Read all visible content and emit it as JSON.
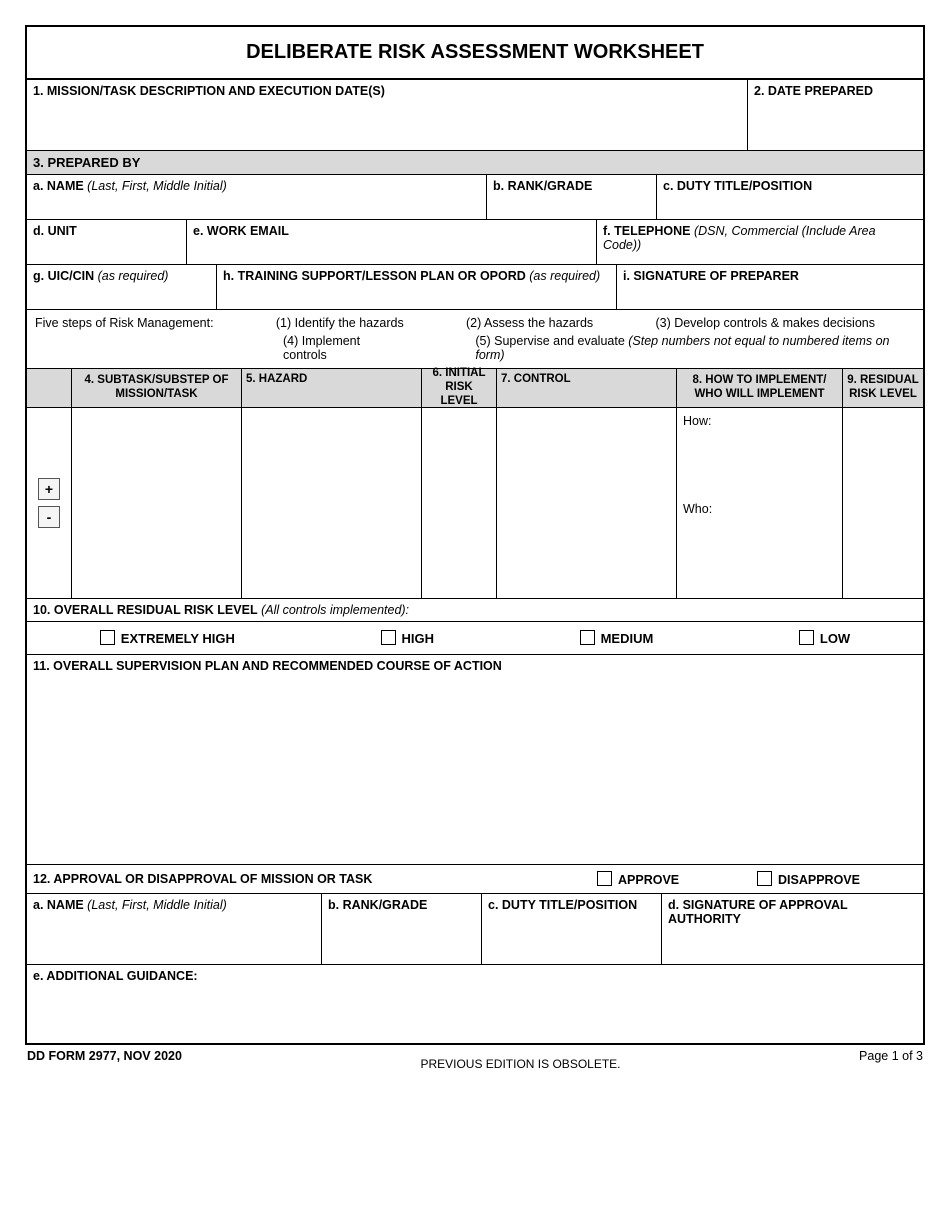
{
  "title": "DELIBERATE RISK ASSESSMENT WORKSHEET",
  "sec1": {
    "label": "1. MISSION/TASK DESCRIPTION AND EXECUTION DATE(S)"
  },
  "sec2": {
    "label": "2. DATE PREPARED"
  },
  "sec3": {
    "label": "3. PREPARED BY",
    "a_b": "a. NAME",
    "a_i": " (Last, First, Middle Initial)",
    "b": "b. RANK/GRADE",
    "c": "c. DUTY TITLE/POSITION",
    "d": "d. UNIT",
    "e": "e. WORK EMAIL",
    "f_b": "f. TELEPHONE",
    "f_i": " (DSN, Commercial (Include Area Code))",
    "g_b": "g. UIC/CIN",
    "g_i": " (as required)",
    "h_b": "h. TRAINING SUPPORT/LESSON PLAN OR OPORD",
    "h_i": " (as required)",
    "i": "i. SIGNATURE OF PREPARER"
  },
  "steps": {
    "intro": "Five steps of Risk Management:",
    "s1": "(1) Identify the hazards",
    "s2": "(2) Assess the hazards",
    "s3": "(3) Develop controls & makes decisions",
    "s4": "(4) Implement controls",
    "s5_a": "(5) Supervise and evaluate ",
    "s5_b": "(Step numbers not equal to numbered items on form)"
  },
  "tbl": {
    "pm": "",
    "c4a": "4. SUBTASK/SUBSTEP OF",
    "c4b": "MISSION/TASK",
    "c5": "5. HAZARD",
    "c6a": "6. INITIAL",
    "c6b": "RISK LEVEL",
    "c7": "7. CONTROL",
    "c8a": "8. HOW TO IMPLEMENT/",
    "c8b": "WHO WILL IMPLEMENT",
    "c9a": "9. RESIDUAL",
    "c9b": "RISK LEVEL",
    "how": "How:",
    "who": "Who:",
    "plus": "+",
    "minus": "-"
  },
  "sec10": {
    "label_b": "10. OVERALL RESIDUAL RISK LEVEL",
    "label_i": " (All controls implemented):",
    "o1": "EXTREMELY HIGH",
    "o2": "HIGH",
    "o3": "MEDIUM",
    "o4": "LOW"
  },
  "sec11": {
    "label": "11. OVERALL SUPERVISION PLAN AND RECOMMENDED COURSE OF ACTION"
  },
  "sec12": {
    "label": "12. APPROVAL OR DISAPPROVAL OF MISSION OR TASK",
    "approve": "APPROVE",
    "disapprove": "DISAPPROVE",
    "a_b": "a. NAME",
    "a_i": " (Last, First, Middle Initial)",
    "b": "b. RANK/GRADE",
    "c": "c. DUTY TITLE/POSITION",
    "d": "d. SIGNATURE OF APPROVAL AUTHORITY",
    "e": "e. ADDITIONAL GUIDANCE:"
  },
  "footer": {
    "left": "DD FORM 2977, NOV 2020",
    "center": "PREVIOUS EDITION IS OBSOLETE.",
    "right": "Page 1 of 3"
  }
}
